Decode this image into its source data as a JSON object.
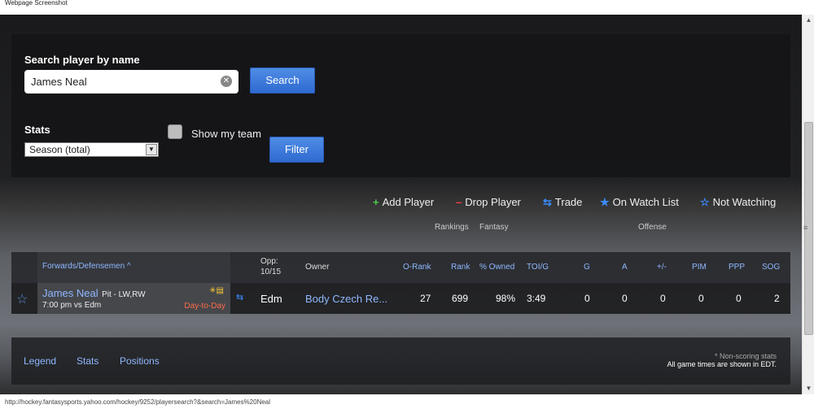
{
  "window": {
    "title": "Webpage Screenshot"
  },
  "status_url": "http://hockey.fantasysports.yahoo.com/hockey/9252/playersearch?&search=James%20Neal",
  "search": {
    "label": "Search player by name",
    "value": "James Neal",
    "clear_glyph": "✕",
    "button": "Search"
  },
  "stats": {
    "label": "Stats",
    "selected": "Season (total)",
    "show_team_label": "Show my team",
    "filter_button": "Filter"
  },
  "actions": [
    {
      "icon": "+",
      "label": "Add Player"
    },
    {
      "icon": "–",
      "label": "Drop Player"
    },
    {
      "icon": "⇆",
      "label": "Trade"
    },
    {
      "icon": "★",
      "label": "On Watch List"
    },
    {
      "icon": "☆",
      "label": "Not Watching"
    }
  ],
  "groups": {
    "rankings": "Rankings",
    "fantasy": "Fantasy",
    "offense": "Offense"
  },
  "table": {
    "forwards_label": "Forwards/Defensemen",
    "opp_label": "Opp:",
    "opp_date": "10/15",
    "owner": "Owner",
    "orank": "O-Rank",
    "rank": "Rank",
    "owned": "% Owned",
    "toi": "TOI/G",
    "g": "G",
    "a": "A",
    "pm": "+/-",
    "pim": "PIM",
    "ppp": "PPP",
    "sog": "SOG"
  },
  "player": {
    "name": "James Neal",
    "team_pos": "Pit - LW,RW",
    "game": "7:00 pm vs Edm",
    "status": "Day-to-Day",
    "opp": "Edm",
    "owner": "Body Czech Re...",
    "orank": "27",
    "rank": "699",
    "owned": "98%",
    "toi": "3:49",
    "g": "0",
    "a": "0",
    "pm": "0",
    "pim": "0",
    "ppp": "0",
    "sog": "2"
  },
  "footer": {
    "legend": "Legend",
    "stats": "Stats",
    "positions": "Positions",
    "nonscoring": "* Non-scoring stats",
    "times": "All game times are shown in EDT."
  }
}
